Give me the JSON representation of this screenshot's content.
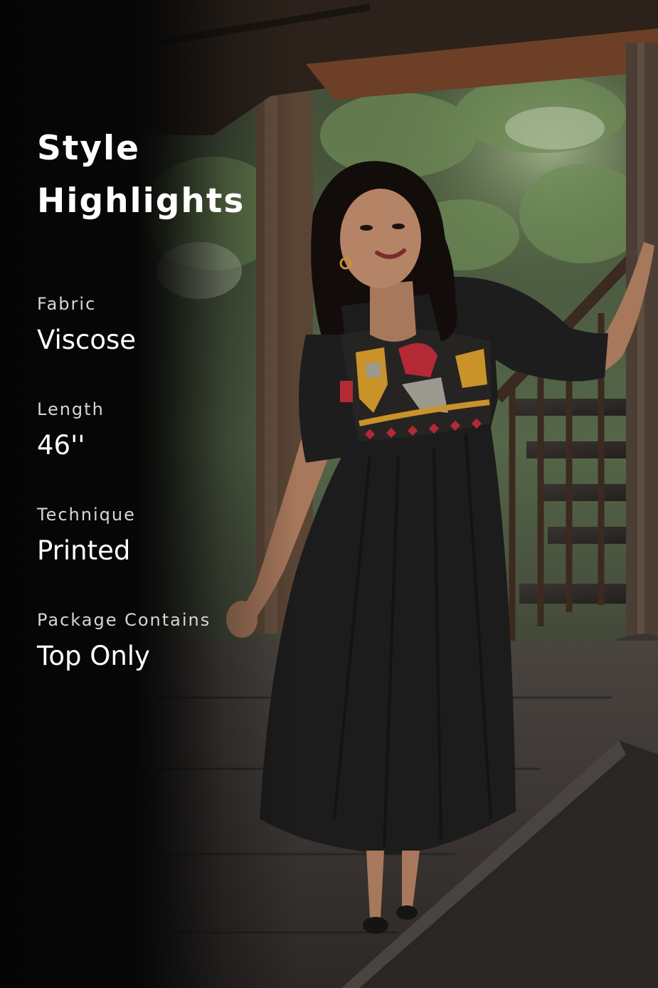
{
  "heading": {
    "line1": "Style",
    "line2": "Highlights"
  },
  "specs": [
    {
      "label": "Fabric",
      "value": "Viscose"
    },
    {
      "label": "Length",
      "value": "46''"
    },
    {
      "label": "Technique",
      "value": "Printed"
    },
    {
      "label": "Package Contains",
      "value": "Top Only"
    }
  ],
  "photo": {
    "subject": "model-in-black-printed-dress-icon",
    "colors": {
      "panel": "#070707",
      "dress": "#1c1c1c",
      "yoke_mustard": "#c9932a",
      "yoke_red": "#b32a35",
      "yoke_grey": "#9c9a8f",
      "foliage": "#4d6b3a",
      "wood": "#4a3324"
    }
  }
}
